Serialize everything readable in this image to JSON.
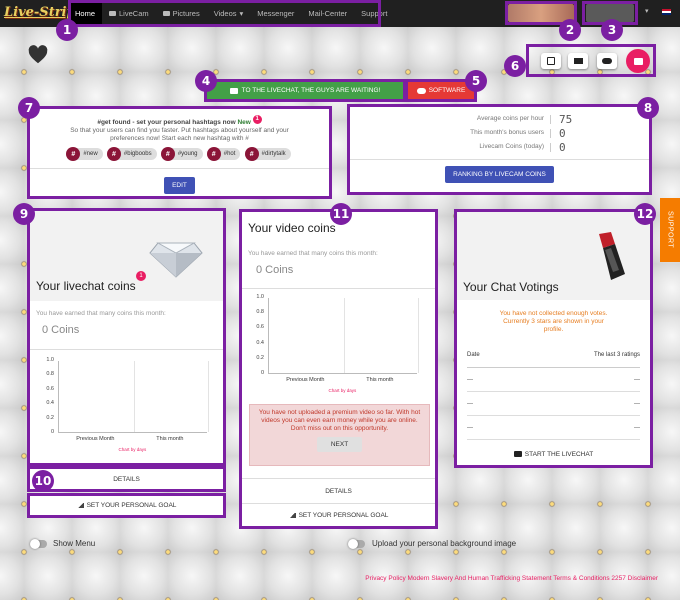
{
  "brand": {
    "logo": "Live-Strip"
  },
  "nav": {
    "items": [
      {
        "label": "Home",
        "active": true
      },
      {
        "label": "LiveCam",
        "icon": "video-icon"
      },
      {
        "label": "Pictures",
        "icon": "image-icon"
      },
      {
        "label": "Videos",
        "dropdown": true
      },
      {
        "label": "Messenger"
      },
      {
        "label": "Mail-Center"
      },
      {
        "label": "Support"
      }
    ],
    "videos_caret": "▾",
    "language_flag": "uk-flag-icon",
    "language_caret": "▾"
  },
  "annotations": [
    "1",
    "2",
    "3",
    "4",
    "5",
    "6",
    "7",
    "8",
    "9",
    "10",
    "11",
    "12"
  ],
  "actions": {
    "livechat_button": "TO THE LIVECHAT, THE GUYS ARE WAITING!",
    "software_button": "SOFTWARE"
  },
  "hashtags": {
    "title": "#get found - set your personal hashtags now",
    "title_new": "New",
    "notification_count": "1",
    "description": "So that your users can find you faster. Put hashtags about yourself and your preferences now! Start each new hashtag with #",
    "tags": [
      "#new",
      "#bigboobs",
      "#young",
      "#hot",
      "#dirtytalk"
    ],
    "hash_symbol": "#",
    "edit_button": "EDIT"
  },
  "stats": {
    "rows": [
      {
        "label": "Average coins per hour",
        "value": "75"
      },
      {
        "label": "This month's bonus users",
        "value": "0"
      },
      {
        "label": "Livecam Coins (today)",
        "value": "0"
      }
    ],
    "ranking_button": "RANKING BY LIVECAM COINS"
  },
  "livechat_coins": {
    "title": "Your livechat coins",
    "badge": "1",
    "earned_text": "You have earned that many coins this month:",
    "coins": "0 Coins",
    "details_button": "DETAILS",
    "goal_button": "SET YOUR PERSONAL GOAL"
  },
  "video_coins": {
    "title": "Your video coins",
    "earned_text": "You have earned that many coins this month:",
    "coins": "0 Coins",
    "warning": "You have not uploaded a premium video so far. With hot videos you can even earn money while you are online. Don't miss out on this opportunity.",
    "next_button": "NEXT",
    "details_button": "DETAILS",
    "goal_button": "SET YOUR PERSONAL GOAL"
  },
  "chart_data": [
    {
      "type": "bar",
      "categories": [
        "Previous Month",
        "This month"
      ],
      "values": [
        0,
        0
      ],
      "yticks": [
        "1.0",
        "0.8",
        "0.6",
        "0.4",
        "0.2",
        "0"
      ],
      "ylim": [
        0,
        1
      ],
      "note": "Chart by days",
      "grid": true
    },
    {
      "type": "bar",
      "categories": [
        "Previous Month",
        "This month"
      ],
      "values": [
        0,
        0
      ],
      "yticks": [
        "1.0",
        "0.8",
        "0.6",
        "0.4",
        "0.2",
        "0"
      ],
      "ylim": [
        0,
        1
      ],
      "note": "Chart by days",
      "grid": true
    }
  ],
  "votings": {
    "title": "Your Chat Votings",
    "notice": "You have not collected enough votes. Currently 3 stars are shown in your profile.",
    "col_date": "Date",
    "col_ratings": "The last 3 ratings",
    "rows": [
      {
        "date": "---",
        "rating": "---"
      },
      {
        "date": "---",
        "rating": "---"
      },
      {
        "date": "---",
        "rating": "---"
      }
    ],
    "start_button": "START THE LIVECHAT"
  },
  "support_tab": "SUPPORT",
  "toggles": {
    "show_menu": "Show Menu",
    "upload_bg": "Upload your personal background image"
  },
  "footer": {
    "links": "Privacy Policy Modern Slavery And Human Trafficking Statement Terms & Conditions 2257 Disclaimer"
  },
  "colors": {
    "accent": "#7b1fa2",
    "pink": "#e91e63",
    "green": "#43a047",
    "red": "#e53935",
    "blue": "#3f51b5",
    "orange": "#f57c00"
  }
}
